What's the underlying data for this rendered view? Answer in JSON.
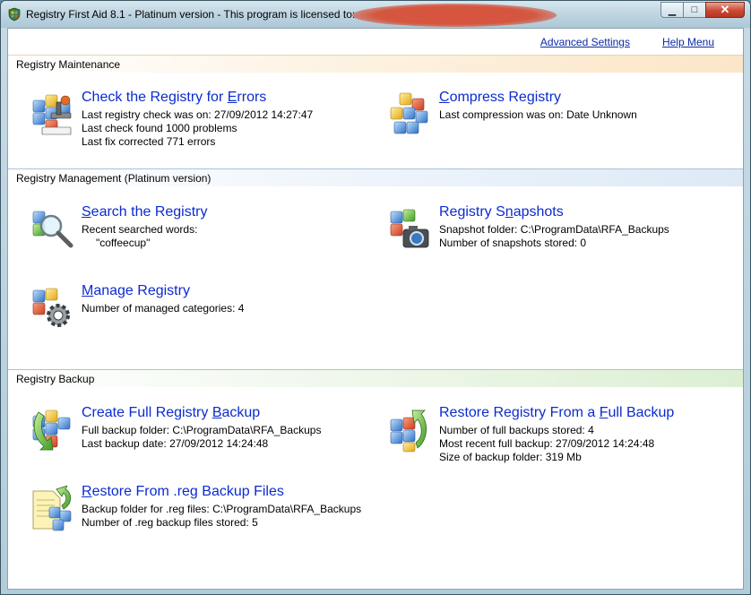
{
  "window": {
    "title": "Registry First Aid 8.1 - Platinum version - This program is licensed to:",
    "minimize": "▁",
    "maximize": "□",
    "close": "✕"
  },
  "links": {
    "advanced_settings": "Advanced Settings",
    "help_menu": "Help Menu"
  },
  "sections": {
    "maintenance": "Registry Maintenance",
    "management": "Registry Management (Platinum version)",
    "backup": "Registry Backup"
  },
  "items": {
    "check": {
      "pre": "Check the Registry for ",
      "hot": "E",
      "post": "rrors",
      "lines": [
        "Last registry check was on: 27/09/2012 14:27:47",
        "Last check found 1000 problems",
        "Last fix corrected 771 errors"
      ],
      "icon": "registry-check-icon"
    },
    "compress": {
      "pre": "",
      "hot": "C",
      "post": "ompress Registry",
      "lines": [
        "Last compression was on: Date Unknown"
      ],
      "icon": "registry-compress-icon"
    },
    "search": {
      "pre": "",
      "hot": "S",
      "post": "earch the Registry",
      "lines": [
        "Recent searched words:",
        "\"coffeecup\""
      ],
      "icon": "magnifier-icon"
    },
    "snapshots": {
      "pre": "Registry S",
      "hot": "n",
      "post": "apshots",
      "lines": [
        "Snapshot folder: C:\\ProgramData\\RFA_Backups",
        "Number of snapshots stored: 0"
      ],
      "icon": "camera-icon"
    },
    "manage": {
      "pre": "",
      "hot": "M",
      "post": "anage Registry",
      "lines": [
        "Number of managed categories: 4"
      ],
      "icon": "gear-icon"
    },
    "full_backup": {
      "pre": "Create Full Registry ",
      "hot": "B",
      "post": "ackup",
      "lines": [
        "Full backup folder: C:\\ProgramData\\RFA_Backups",
        "Last backup date: 27/09/2012 14:24:48"
      ],
      "icon": "backup-arrow-icon"
    },
    "restore_full": {
      "pre": "Restore Registry From a ",
      "hot": "F",
      "post": "ull Backup",
      "lines": [
        "Number of full backups stored: 4",
        "Most recent full backup: 27/09/2012 14:24:48",
        "Size of backup folder: 319 Mb"
      ],
      "icon": "restore-arrow-icon"
    },
    "restore_reg": {
      "pre": "",
      "hot": "R",
      "post": "estore From .reg Backup Files",
      "lines": [
        "Backup folder for .reg files: C:\\ProgramData\\RFA_Backups",
        "Number of .reg backup files stored: 5"
      ],
      "icon": "reg-file-icon"
    }
  },
  "colors": {
    "link": "#0b2bd0",
    "title_bar": "#bcd3e0",
    "close_button": "#c94a33",
    "redaction": "#d4573f"
  }
}
